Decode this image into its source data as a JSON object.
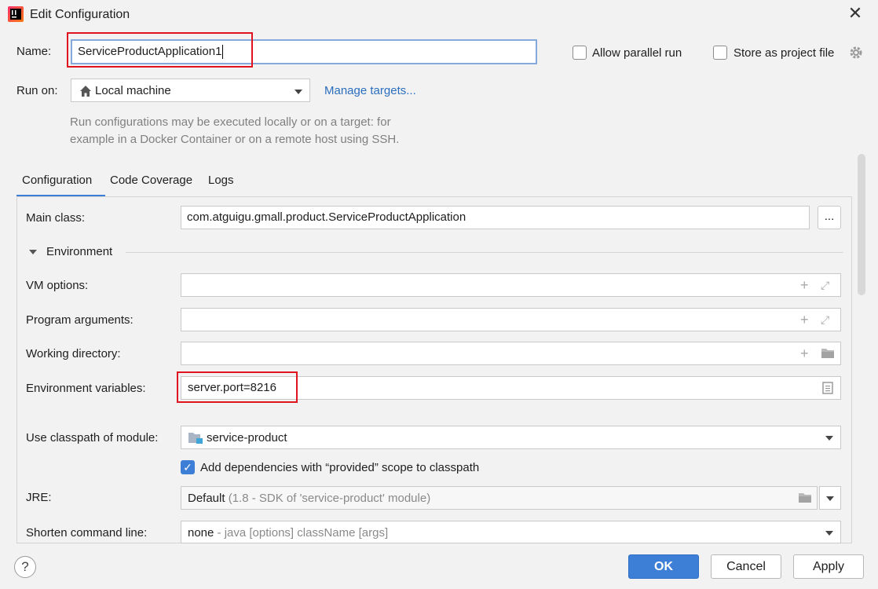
{
  "window": {
    "title": "Edit Configuration",
    "icon": "intellij-icon",
    "close_icon": "close-icon"
  },
  "name": {
    "label": "Name:",
    "value": "ServiceProductApplication1"
  },
  "options": {
    "allow_parallel_run": {
      "label": "Allow parallel run",
      "checked": false
    },
    "store_as_project_file": {
      "label": "Store as project file",
      "checked": false
    }
  },
  "run_on": {
    "label": "Run on:",
    "value": "Local machine",
    "icon": "home-icon",
    "manage_link": "Manage targets...",
    "hint_line1": "Run configurations may be executed locally or on a target: for",
    "hint_line2": "example in a Docker Container or on a remote host using SSH."
  },
  "tabs": [
    {
      "label": "Configuration",
      "active": true
    },
    {
      "label": "Code Coverage",
      "active": false
    },
    {
      "label": "Logs",
      "active": false
    }
  ],
  "config": {
    "main_class": {
      "label": "Main class:",
      "value": "com.atguigu.gmall.product.ServiceProductApplication",
      "browse": "..."
    },
    "environment_section": "Environment",
    "vm_options": {
      "label": "VM options:",
      "value": ""
    },
    "program_arguments": {
      "label": "Program arguments:",
      "value": ""
    },
    "working_directory": {
      "label": "Working directory:",
      "value": ""
    },
    "environment_variables": {
      "label": "Environment variables:",
      "value": "server.port=8216"
    },
    "classpath_module": {
      "label": "Use classpath of module:",
      "value": "service-product"
    },
    "add_dependencies": {
      "label": "Add dependencies with “provided” scope to classpath",
      "checked": true
    },
    "jre": {
      "label": "JRE:",
      "value": "Default",
      "detail": "(1.8 - SDK of 'service-product' module)"
    },
    "shorten_command_line": {
      "label": "Shorten command line:",
      "value": "none",
      "detail": "- java [options] className [args]"
    }
  },
  "footer": {
    "help": "?",
    "ok": "OK",
    "cancel": "Cancel",
    "apply": "Apply"
  },
  "colors": {
    "accent": "#3d7fd6",
    "link": "#2a6ebd",
    "highlight_box": "#e0141e"
  }
}
